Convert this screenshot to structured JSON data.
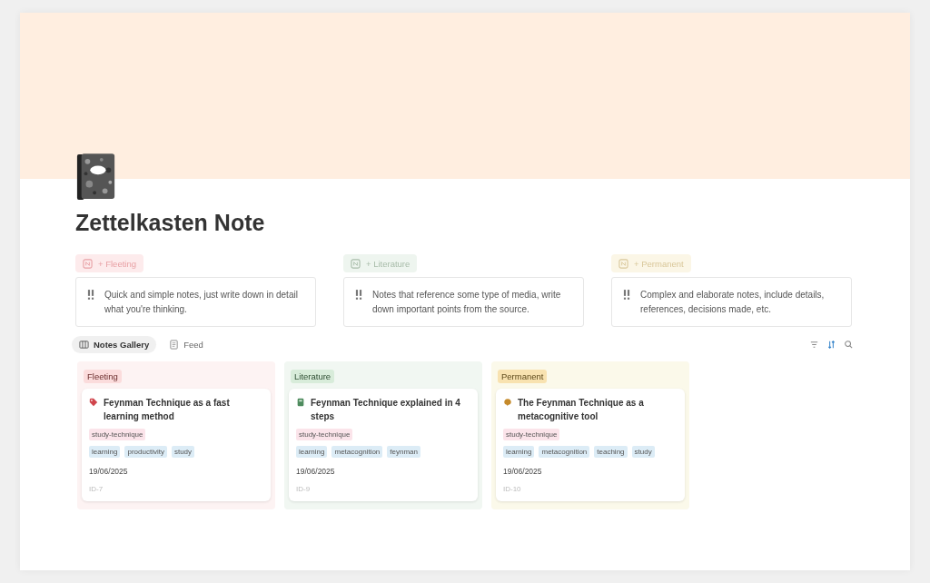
{
  "page": {
    "title": "Zettelkasten Note"
  },
  "note_types": [
    {
      "kind": "fleeting",
      "button": "+ Fleeting",
      "description": "Quick and simple notes, just write down in detail what you're thinking."
    },
    {
      "kind": "literature",
      "button": "+ Literature",
      "description": "Notes that reference some type of media, write down important points from the source."
    },
    {
      "kind": "permanent",
      "button": "+ Permanent",
      "description": "Complex and elaborate notes, include details, references, decisions made, etc."
    }
  ],
  "views": [
    {
      "label": "Notes Gallery",
      "kind": "gallery",
      "selected": true
    },
    {
      "label": "Feed",
      "kind": "feed",
      "selected": false
    }
  ],
  "sort_active": true,
  "groups": [
    {
      "kind": "fleeting",
      "label": "Fleeting",
      "cards": [
        {
          "title": "Feynman Technique as a fast learning method",
          "category": "study-technique",
          "tags": [
            "learning",
            "productivity",
            "study"
          ],
          "date": "19/06/2025",
          "id": "ID-7"
        }
      ]
    },
    {
      "kind": "literature",
      "label": "Literature",
      "cards": [
        {
          "title": "Feynman Technique explained in 4 steps",
          "category": "study-technique",
          "tags": [
            "learning",
            "metacognition",
            "feynman"
          ],
          "date": "19/06/2025",
          "id": "ID-9"
        }
      ]
    },
    {
      "kind": "permanent",
      "label": "Permanent",
      "cards": [
        {
          "title": "The Feynman Technique as a metacognitive tool",
          "category": "study-technique",
          "tags": [
            "learning",
            "metacognition",
            "teaching",
            "study"
          ],
          "date": "19/06/2025",
          "id": "ID-10"
        }
      ]
    }
  ]
}
